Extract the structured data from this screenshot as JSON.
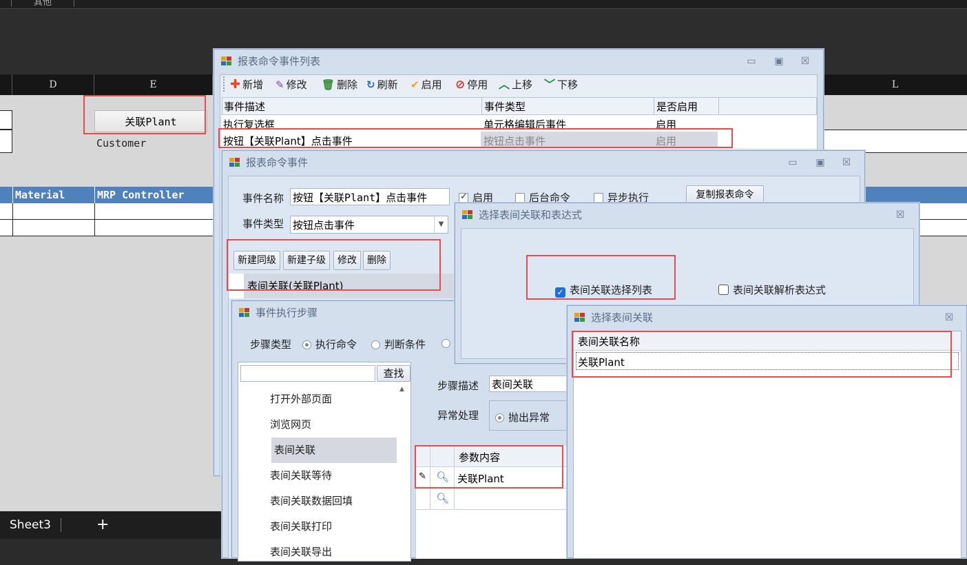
{
  "spreadsheet": {
    "top_label": "其他",
    "columns": {
      "d": "D",
      "e": "E",
      "l": "L"
    },
    "button_cell": "关联Plant",
    "customer_cell": "Customer",
    "header_row": {
      "material": "Material",
      "mrp_controller": "MRP Controller"
    },
    "sheet_tab": "Sheet3",
    "add_sheet": "+"
  },
  "event_list_window": {
    "title": "报表命令事件列表",
    "toolbar": [
      {
        "icon": "plus-icon",
        "label": "新增",
        "color": "#e8491d"
      },
      {
        "icon": "pencil-icon",
        "label": "修改",
        "color": "#7b3fa0"
      },
      {
        "icon": "trash-icon",
        "label": "删除",
        "color": "#3a8a3a"
      },
      {
        "icon": "refresh-icon",
        "label": "刷新",
        "color": "#2a6fb0"
      },
      {
        "icon": "check-icon",
        "label": "启用",
        "color": "#f0a21c"
      },
      {
        "icon": "ban-icon",
        "label": "停用",
        "color": "#e03030"
      },
      {
        "icon": "up-icon",
        "label": "上移",
        "color": "#1e8a3a"
      },
      {
        "icon": "down-icon",
        "label": "下移",
        "color": "#1e8a3a"
      }
    ],
    "grid_headers": {
      "desc": "事件描述",
      "type": "事件类型",
      "enabled": "是否启用"
    },
    "rows": [
      {
        "desc": "执行复选框",
        "type": "单元格编辑后事件",
        "enabled": "启用"
      },
      {
        "desc": "按钮【关联Plant】点击事件",
        "type": "按钮点击事件",
        "enabled": "启用"
      }
    ]
  },
  "event_window": {
    "title": "报表命令事件",
    "name_label": "事件名称",
    "name_value": "按钮【关联Plant】点击事件",
    "enabled_label": "启用",
    "background_label": "后台命令",
    "async_label": "异步执行",
    "copy_button": "复制报表命令",
    "type_label": "事件类型",
    "type_value": "按钮点击事件",
    "buttons": {
      "new_sibling": "新建同级",
      "new_child": "新建子级",
      "edit": "修改",
      "delete": "删除"
    },
    "tree_item": "表间关联(关联Plant)"
  },
  "step_window": {
    "title": "事件执行步骤",
    "step_type_label": "步骤类型",
    "option_exec": "执行命令",
    "option_cond": "判断条件",
    "search_button": "查找",
    "list_items": [
      "打开外部页面",
      "浏览网页",
      "表间关联",
      "表间关联等待",
      "表间关联数据回填",
      "表间关联打印",
      "表间关联导出"
    ],
    "selected_index": 2,
    "desc_label": "步骤描述",
    "desc_value": "表间关联",
    "error_label": "异常处理",
    "error_option": "抛出异常",
    "param_header": "参数内容",
    "param_value": "关联Plant"
  },
  "select_expr_window": {
    "title": "选择表间关联和表达式",
    "option_list": "表间关联选择列表",
    "option_expr": "表间关联解析表达式"
  },
  "select_link_window": {
    "title": "选择表间关联",
    "header": "表间关联名称",
    "row": "关联Plant"
  },
  "window_buttons": {
    "minimize": "▭",
    "maximize": "▣",
    "close": "☒"
  },
  "colors": {
    "highlight": "#e84b4b",
    "checkbox_blue": "#1e6fd9",
    "header_blue": "#4f81bd"
  }
}
